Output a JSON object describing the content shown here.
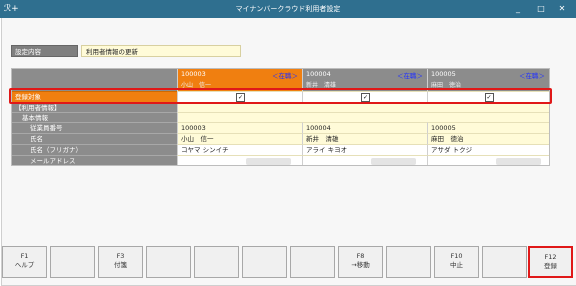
{
  "window": {
    "title": "マイナンバークラウド利用者設定",
    "app_icon": "ℛ+",
    "minimize": "_",
    "maximize": "□",
    "close": "✕"
  },
  "settings": {
    "label": "設定内容",
    "value": "利用者情報の更新"
  },
  "employees": [
    {
      "code": "100003",
      "status": "＜在職＞",
      "name": "小山　信一",
      "emp_no": "100003",
      "full_name": "小山　信一",
      "kana": "コヤマ シンイチ",
      "checked": true,
      "selected": true
    },
    {
      "code": "100004",
      "status": "＜在職＞",
      "name": "新井　清雄",
      "emp_no": "100004",
      "full_name": "新井　清雄",
      "kana": "アライ キヨオ",
      "checked": true,
      "selected": false
    },
    {
      "code": "100005",
      "status": "＜在職＞",
      "name": "麻田　徳治",
      "emp_no": "100005",
      "full_name": "麻田　徳治",
      "kana": "アサダ トクジ",
      "checked": true,
      "selected": false
    }
  ],
  "rows": {
    "target": "登録対象",
    "user_info": "【利用者情報】",
    "basic": "基本情報",
    "emp_no": "従業員番号",
    "name": "氏名",
    "kana": "氏名（フリガナ）",
    "email": "メールアドレス"
  },
  "check_mark": "✓",
  "fkeys": [
    {
      "key": "F1",
      "label": "ヘルプ"
    },
    {
      "key": "",
      "label": ""
    },
    {
      "key": "F3",
      "label": "付箋"
    },
    {
      "key": "",
      "label": ""
    },
    {
      "key": "",
      "label": ""
    },
    {
      "key": "",
      "label": ""
    },
    {
      "key": "",
      "label": ""
    },
    {
      "key": "F8",
      "label": "→移動"
    },
    {
      "key": "",
      "label": ""
    },
    {
      "key": "F10",
      "label": "中止"
    },
    {
      "key": "",
      "label": ""
    },
    {
      "key": "F12",
      "label": "登録"
    }
  ]
}
